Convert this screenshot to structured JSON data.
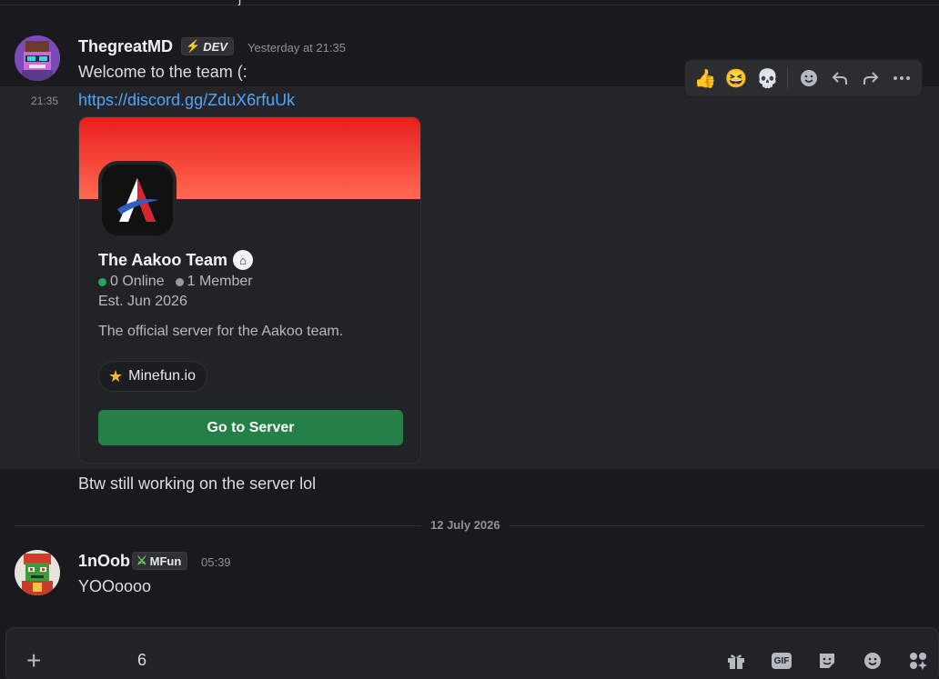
{
  "top_fragment": "j",
  "message1": {
    "username": "ThegreatMD",
    "badge": "DEV",
    "timestamp": "Yesterday at 21:35",
    "text": "Welcome to the team (:",
    "side_time": "21:35",
    "link": "https://discord.gg/ZduX6rfuUk",
    "followup": "Btw still working on the server lol"
  },
  "toolbar": {
    "icons": [
      "thumbs-up-icon",
      "grinning-squint-icon",
      "skull-icon",
      "add-reaction-icon",
      "reply-icon",
      "forward-icon",
      "more-icon"
    ]
  },
  "invite": {
    "server_name": "The Aakoo Team",
    "online": "0 Online",
    "members": "1 Member",
    "established": "Est. Jun 2026",
    "description": "The official server for the Aakoo team.",
    "tag": "Minefun.io",
    "button": "Go to Server"
  },
  "divider": {
    "date": "12 July 2026"
  },
  "message2": {
    "username": "1nOob",
    "badge": "MFun",
    "timestamp": "05:39",
    "text": "YOOoooo"
  },
  "composer": {
    "value": "6",
    "gif_label": "GIF"
  },
  "colors": {
    "background": "#1a1a1e",
    "link": "#4aa6ff",
    "button": "#248046",
    "banner_top": "#e81d1d",
    "banner_bottom": "#ff6a52"
  }
}
